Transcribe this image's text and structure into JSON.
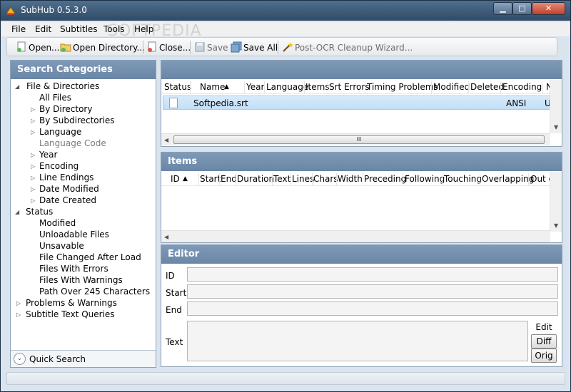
{
  "window": {
    "title": "SubHub 0.5.3.0"
  },
  "menu": [
    "File",
    "Edit",
    "Subtitles",
    "Tools",
    "Help"
  ],
  "toolbar": {
    "open": "Open...",
    "open_directory": "Open Directory...",
    "close": "Close...",
    "save": "Save",
    "save_all": "Save All",
    "ocr_wizard": "Post-OCR Cleanup Wizard..."
  },
  "left_panel": {
    "header": "Search Categories",
    "tree": [
      "File & Directories",
      "All Files",
      "By Directory",
      "By Subdirectories",
      "Language",
      "Language Code",
      "Year",
      "Encoding",
      "Line Endings",
      "Date Modified",
      "Date Created",
      "Status",
      "Modified",
      "Unloadable Files",
      "Unsavable",
      "File Changed After Load",
      "Files With Errors",
      "Files With Warnings",
      "Path Over 245 Characters",
      "Problems & Warnings",
      "Subtitle Text Queries"
    ],
    "quick_search": "Quick Search"
  },
  "files_panel": {
    "columns": [
      "Status",
      "Name",
      "Year",
      "Language",
      "Items",
      "Srt Errors",
      "Timing Problems",
      "Modified",
      "Deleted",
      "Encoding",
      "N"
    ],
    "rows": [
      {
        "name": "Softpedia.srt",
        "encoding": "ANSI",
        "last": "U"
      }
    ],
    "scroll_grip": "III"
  },
  "items_panel": {
    "header": "Items",
    "columns": [
      "ID",
      "Start",
      "End",
      "Duration",
      "Text",
      "Lines",
      "Chars",
      "Width",
      "Preceding",
      "Following",
      "Touching",
      "Overlapping",
      "Out o"
    ]
  },
  "editor": {
    "header": "Editor",
    "labels": {
      "id": "ID",
      "start": "Start",
      "end": "End",
      "text": "Text"
    },
    "buttons": {
      "edit": "Edit",
      "diff": "Diff",
      "orig": "Orig"
    }
  },
  "watermark": "SOFTPEDIA",
  "colors": {
    "panel_header": "#7590b0",
    "selection": "#c8e2f8",
    "chrome": "#d9e4ef"
  }
}
